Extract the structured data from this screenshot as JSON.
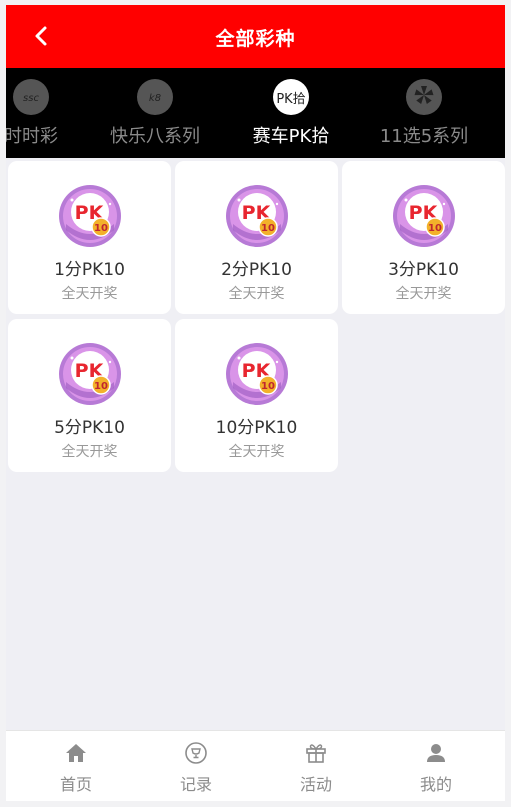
{
  "header": {
    "title": "全部彩种",
    "back_icon": "chevron-left-icon"
  },
  "tabs": [
    {
      "label": "时时彩",
      "icon": "ssc-logo-icon",
      "active": false
    },
    {
      "label": "快乐八系列",
      "icon": "happy8-logo-icon",
      "active": false
    },
    {
      "label": "赛车PK拾",
      "icon": "pk10-logo-icon",
      "icon_text": "PK拾",
      "active": true
    },
    {
      "label": "11选5系列",
      "icon": "11x5-logo-icon",
      "active": false
    }
  ],
  "games": [
    {
      "name": "1分PK10",
      "sub": "全天开奖",
      "icon": "pk10-badge-icon"
    },
    {
      "name": "2分PK10",
      "sub": "全天开奖",
      "icon": "pk10-badge-icon"
    },
    {
      "name": "3分PK10",
      "sub": "全天开奖",
      "icon": "pk10-badge-icon"
    },
    {
      "name": "5分PK10",
      "sub": "全天开奖",
      "icon": "pk10-badge-icon"
    },
    {
      "name": "10分PK10",
      "sub": "全天开奖",
      "icon": "pk10-badge-icon"
    }
  ],
  "badge_text": {
    "pk": "PK",
    "num": "10"
  },
  "nav": [
    {
      "label": "首页",
      "icon": "home-icon"
    },
    {
      "label": "记录",
      "icon": "trophy-record-icon"
    },
    {
      "label": "活动",
      "icon": "gift-icon"
    },
    {
      "label": "我的",
      "icon": "user-icon"
    }
  ],
  "colors": {
    "header_bg": "#ff0000",
    "tabs_bg": "#000000",
    "page_bg": "#efeff4"
  }
}
